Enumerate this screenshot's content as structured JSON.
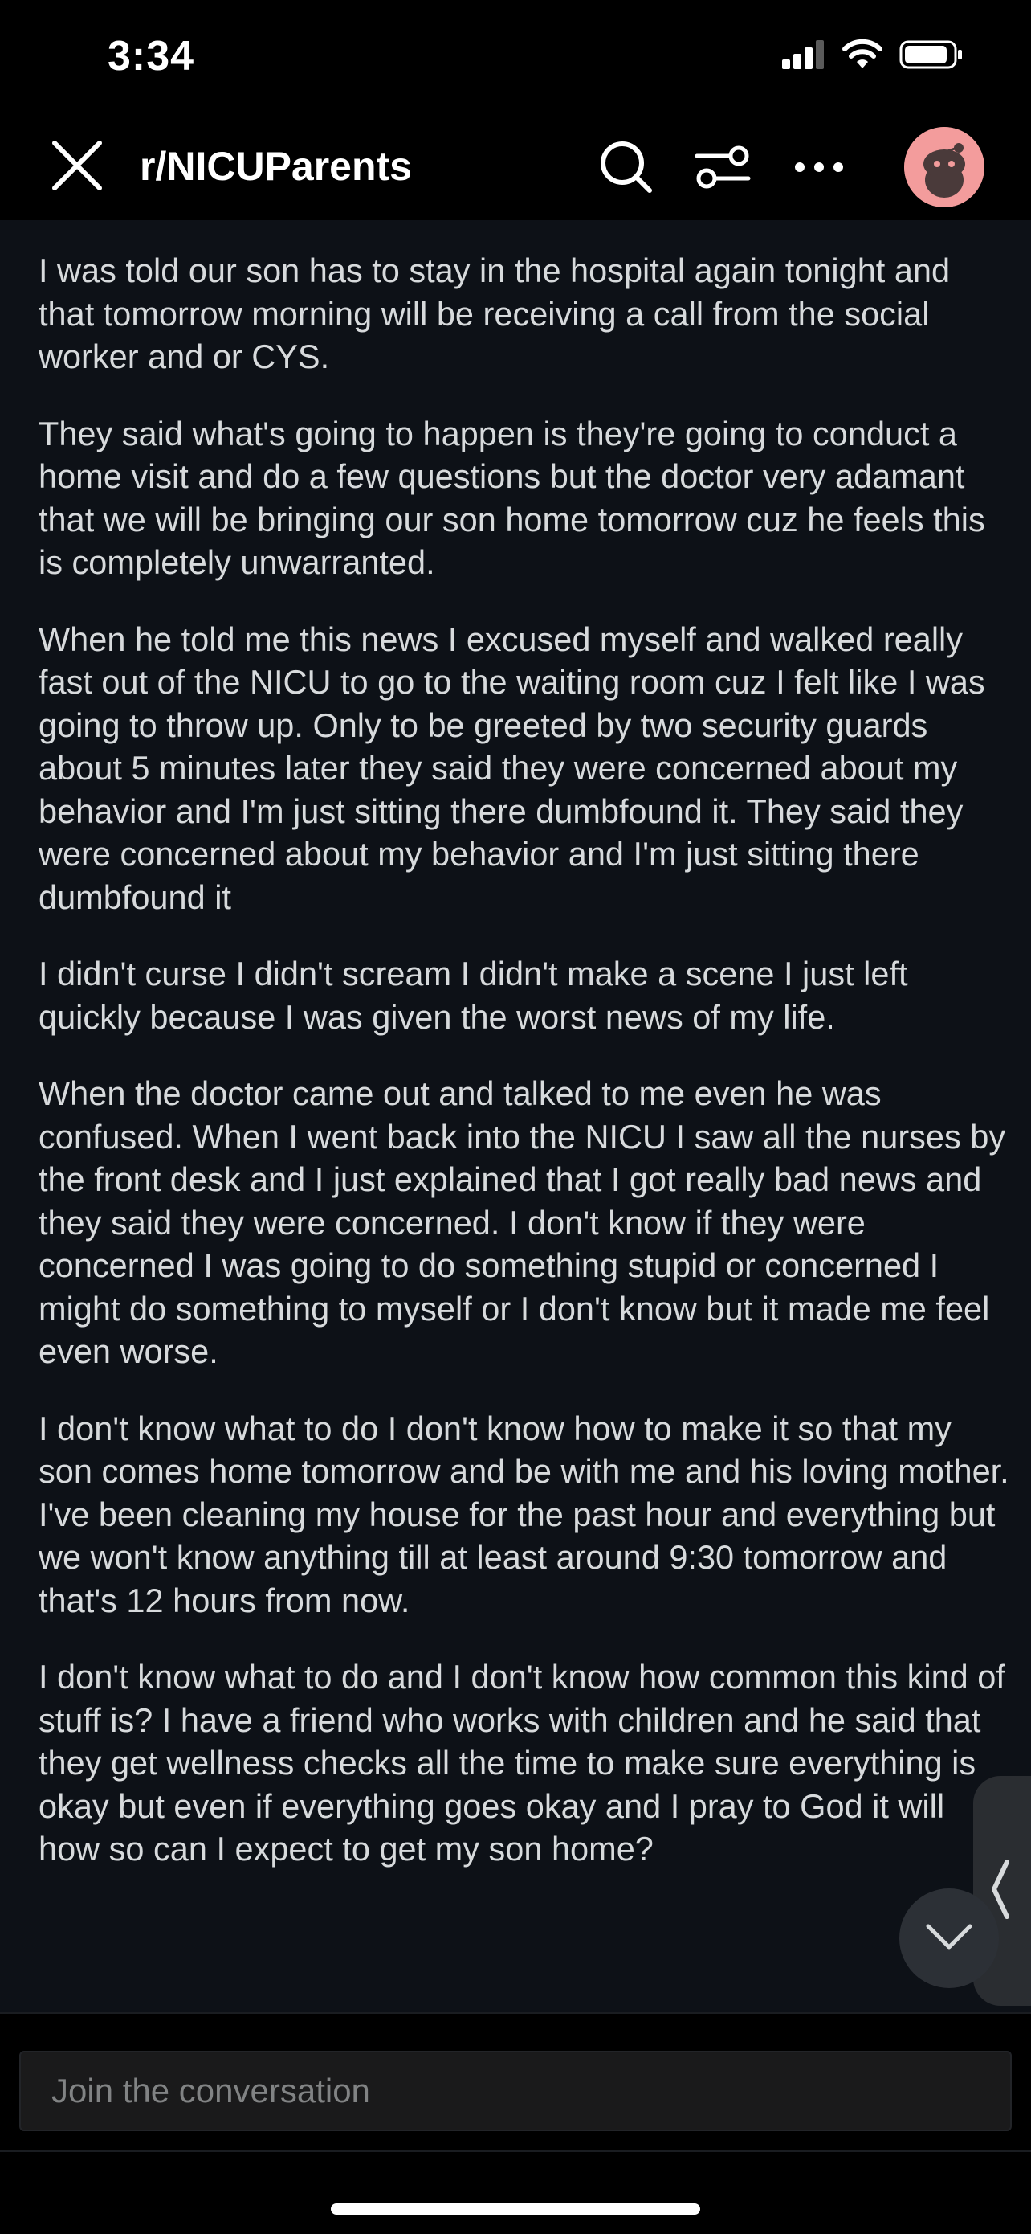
{
  "status_bar": {
    "time": "3:34"
  },
  "header": {
    "subreddit": "r/NICUParents",
    "icons": [
      "close-icon",
      "search-icon",
      "filter-icon",
      "more-icon",
      "avatar"
    ]
  },
  "post": {
    "paragraphs": [
      "I was told our son has to stay in the hospital again tonight and that tomorrow morning will be receiving a call from the social worker and or CYS.",
      "They said what's going to happen is they're going to conduct a home visit and do a few questions but the doctor very adamant that we will be bringing our son home tomorrow cuz he feels this is completely unwarranted.",
      "When he told me this news I excused myself and walked really fast out of the NICU to go to the waiting room cuz I felt like I was going to throw up. Only to be greeted by two security guards about 5 minutes later they said they were concerned about my behavior and I'm just sitting there dumbfound it. They said they were concerned about my behavior and I'm just sitting there dumbfound it",
      "I didn't curse I didn't scream I didn't make a scene I just left quickly because I was given the worst news of my life.",
      "When the doctor came out and talked to me even he was confused. When I went back into the NICU I saw all the nurses by the front desk and I just explained that I got really bad news and they said they were concerned. I don't know if they were concerned I was going to do something stupid or concerned I might do something to myself or I don't know but it made me feel even worse.",
      "I don't know what to do I don't know how to make it so that my son comes home tomorrow and be with me and his loving mother. I've been cleaning my house for the past hour and everything but we won't know anything till at least around 9:30 tomorrow and that's 12 hours from now.",
      "I don't know what to do and I don't know how common this kind of stuff is? I have a friend who works with children and he said that they get wellness checks all the time to make sure everything is okay but even if everything goes okay and I pray to God it will how so can I expect to get my son home?"
    ]
  },
  "comment_bar": {
    "placeholder": "Join the conversation"
  },
  "colors": {
    "background": "#0d1117",
    "text": "#d7dadc",
    "avatar": "#f39c9c"
  }
}
